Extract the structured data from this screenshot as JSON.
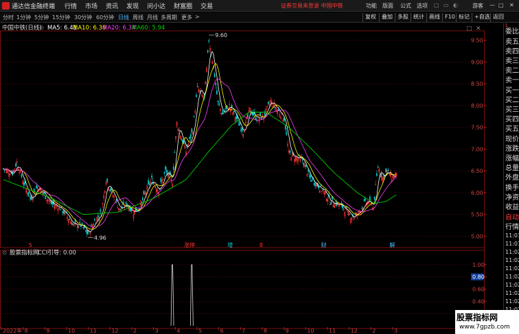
{
  "titlebar": {
    "app_name": "通达信金融终端",
    "menus": [
      "行情",
      "市场",
      "资讯",
      "发现",
      "问小达",
      "财富圈",
      "交易"
    ],
    "warning": "证券交易未登录",
    "stock_tab": "中国中铁",
    "right_menus": [
      "功能",
      "版面",
      "公式",
      "选项"
    ],
    "user": "游客"
  },
  "periodbar": {
    "periods": [
      "分时",
      "1分钟",
      "5分钟",
      "15分钟",
      "30分钟",
      "60分钟",
      "日线",
      "周线",
      "月线",
      "多周期",
      "更多"
    ],
    "active_period": "日线",
    "more_arrow": ">",
    "buttons": [
      "复权",
      "叠加",
      "多股",
      "统计",
      "画线",
      "F10",
      "标记",
      "+自选",
      "返回"
    ]
  },
  "chart_header": {
    "stock": "中国中铁(日线)",
    "ma5": "MA5: 6.41",
    "ma10": "MA10: 6.36",
    "ma20": "MA20: 6.34",
    "ma60": "MA60: 5.94"
  },
  "indicator_header": {
    "name": "股票指标网",
    "cci": "CCI引导: 0.00",
    "current_value_label": "0.80"
  },
  "colors": {
    "up": "#ff3232",
    "down": "#00d0d0",
    "ma5": "#ffffff",
    "ma10": "#ffff00",
    "ma20": "#ff40ff",
    "ma60": "#00d000",
    "grid": "#7a1010"
  },
  "chart_data": {
    "type": "candlestick",
    "price_axis": {
      "ticks": [
        5.0,
        5.5,
        6.0,
        6.5,
        7.0,
        7.5,
        8.0,
        8.5,
        9.0,
        9.5
      ],
      "range": [
        4.85,
        9.7
      ]
    },
    "indicator_axis": {
      "ticks": [
        1.0,
        0.8,
        0.6,
        0.4,
        0.2
      ],
      "range": [
        0,
        1.1
      ]
    },
    "x_ticks": [
      "2022年",
      "8",
      "9",
      "10",
      "11",
      "12",
      "2",
      "3",
      "4",
      "5",
      "6",
      "7",
      "8",
      "9",
      "10",
      "11",
      "12",
      "2",
      "3"
    ],
    "annotations": {
      "high": "9.60",
      "low": "4.96"
    },
    "markers": [
      {
        "label": "5",
        "color": "#ff3232"
      },
      {
        "label": "涨停",
        "color": "#ff3232"
      },
      {
        "label": "增",
        "color": "#00d0d0"
      },
      {
        "label": "8",
        "color": "#ff3232"
      },
      {
        "label": "财",
        "color": "#4ab4ff"
      },
      {
        "label": "解",
        "color": "#4ab4ff"
      }
    ],
    "keypoints_close": [
      [
        0,
        6.55
      ],
      [
        8,
        6.45
      ],
      [
        12,
        6.7
      ],
      [
        18,
        6.2
      ],
      [
        24,
        5.85
      ],
      [
        30,
        6.15
      ],
      [
        36,
        5.95
      ],
      [
        42,
        5.75
      ],
      [
        50,
        5.65
      ],
      [
        56,
        5.45
      ],
      [
        62,
        5.25
      ],
      [
        68,
        5.25
      ],
      [
        74,
        5.05
      ],
      [
        80,
        5.35
      ],
      [
        86,
        5.55
      ],
      [
        90,
        6.3
      ],
      [
        96,
        5.95
      ],
      [
        102,
        5.6
      ],
      [
        108,
        5.75
      ],
      [
        114,
        5.55
      ],
      [
        120,
        5.7
      ],
      [
        126,
        6.1
      ],
      [
        130,
        6.3
      ],
      [
        136,
        6.05
      ],
      [
        142,
        6.5
      ],
      [
        148,
        6.25
      ],
      [
        152,
        7.6
      ],
      [
        156,
        7.25
      ],
      [
        160,
        6.95
      ],
      [
        166,
        7.45
      ],
      [
        170,
        8.4
      ],
      [
        176,
        8.15
      ],
      [
        180,
        9.5
      ],
      [
        184,
        8.9
      ],
      [
        188,
        8.05
      ],
      [
        192,
        7.8
      ],
      [
        198,
        8.0
      ],
      [
        204,
        7.7
      ],
      [
        210,
        7.4
      ],
      [
        216,
        7.9
      ],
      [
        222,
        7.7
      ],
      [
        228,
        7.75
      ],
      [
        234,
        8.1
      ],
      [
        240,
        7.9
      ],
      [
        246,
        7.7
      ],
      [
        250,
        6.9
      ],
      [
        256,
        6.8
      ],
      [
        262,
        6.75
      ],
      [
        268,
        6.35
      ],
      [
        274,
        6.2
      ],
      [
        280,
        6.05
      ],
      [
        286,
        5.8
      ],
      [
        292,
        5.75
      ],
      [
        298,
        5.65
      ],
      [
        304,
        5.45
      ],
      [
        310,
        5.5
      ],
      [
        316,
        5.75
      ],
      [
        320,
        5.8
      ],
      [
        324,
        5.65
      ],
      [
        328,
        6.6
      ],
      [
        332,
        6.35
      ],
      [
        336,
        6.5
      ],
      [
        340,
        6.35
      ],
      [
        344,
        6.4
      ]
    ],
    "ma60_keypoints": [
      [
        0,
        6.3
      ],
      [
        40,
        5.9
      ],
      [
        70,
        5.5
      ],
      [
        100,
        5.55
      ],
      [
        130,
        5.85
      ],
      [
        160,
        6.3
      ],
      [
        180,
        6.95
      ],
      [
        200,
        7.55
      ],
      [
        215,
        7.85
      ],
      [
        230,
        7.85
      ],
      [
        250,
        7.5
      ],
      [
        270,
        7.0
      ],
      [
        290,
        6.45
      ],
      [
        310,
        6.0
      ],
      [
        325,
        5.75
      ],
      [
        335,
        5.8
      ],
      [
        344,
        5.95
      ]
    ],
    "cci_spikes": [
      [
        148,
        1.0
      ],
      [
        165,
        1.0
      ]
    ]
  }
}
